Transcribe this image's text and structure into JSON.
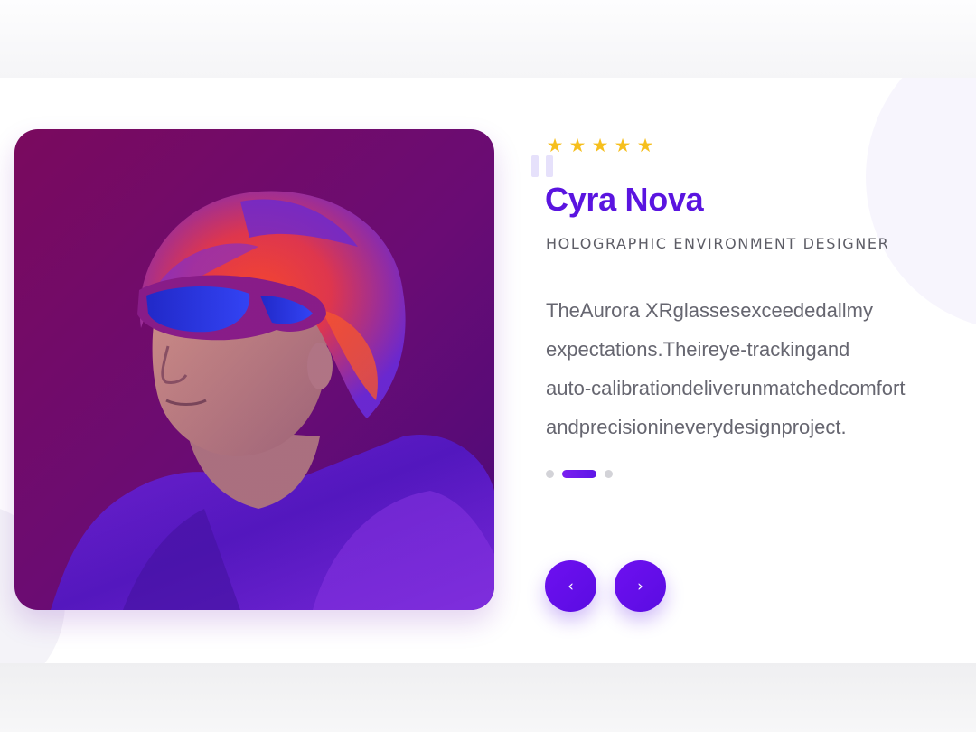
{
  "testimonial": {
    "rating": 5,
    "stars": [
      "★",
      "★",
      "★",
      "★",
      "★"
    ],
    "name": "Cyra Nova",
    "role": "HOLOGRAPHIC ENVIRONMENT DESIGNER",
    "quote_lines": [
      "TheAurora XRglassesexceededallmy",
      "expectations.Theireye-trackingand",
      "auto-calibrationdeliverunmatchedcomfort",
      "andprecisionineverydesignproject."
    ],
    "photo_alt": "Portrait of a man wearing a fuzzy orange and purple hat, purple XR goggles and a purple fur coat against a magenta background"
  },
  "carousel": {
    "slide_count": 3,
    "active_index": 1,
    "prev_icon": "chevron-left-icon",
    "next_icon": "chevron-right-icon",
    "prev_glyph": "‹",
    "next_glyph": "›"
  },
  "colors": {
    "accent": "#5a14e0",
    "star": "#f6bf1d",
    "text_muted": "#666670",
    "dot_inactive": "#d3d3d8"
  }
}
